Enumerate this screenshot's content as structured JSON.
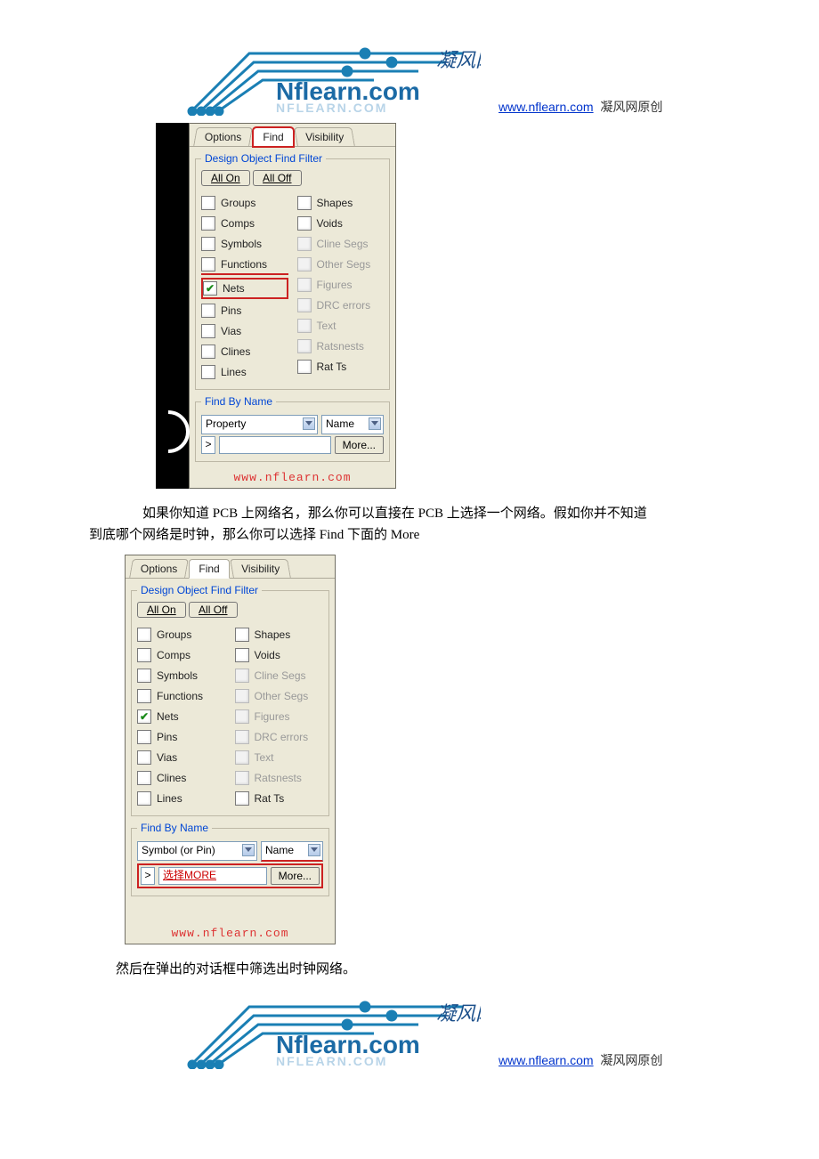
{
  "link_text": "www.nflearn.com",
  "credit_suffix": "凝风网原创",
  "tabs": {
    "options": "Options",
    "find": "Find",
    "visibility": "Visibility"
  },
  "group1_legend": "Design Object Find Filter",
  "all_on": "All On",
  "all_off": "All Off",
  "left_items": [
    "Groups",
    "Comps",
    "Symbols",
    "Functions",
    "Nets",
    "Pins",
    "Vias",
    "Clines",
    "Lines"
  ],
  "right_items": [
    {
      "label": "Shapes",
      "disabled": false
    },
    {
      "label": "Voids",
      "disabled": false
    },
    {
      "label": "Cline Segs",
      "disabled": true
    },
    {
      "label": "Other Segs",
      "disabled": true
    },
    {
      "label": "Figures",
      "disabled": true
    },
    {
      "label": "DRC errors",
      "disabled": true
    },
    {
      "label": "Text",
      "disabled": true
    },
    {
      "label": "Ratsnests",
      "disabled": true
    },
    {
      "label": "Rat Ts",
      "disabled": false
    }
  ],
  "group2_legend": "Find By Name",
  "select1_value": "Property",
  "select2_value": "Name",
  "more_label": "More...",
  "watermark": "www.nflearn.com",
  "paragraph1a": "如果你知道 PCB 上网络名，那么你可以直接在 PCB 上选择一个网络。假如你并不知道",
  "paragraph1b": "到底哪个网络是时钟，那么你可以选择 Find 下面的 More",
  "panel2_select1": "Symbol (or Pin)",
  "panel2_select2": "Name",
  "panel2_input": "选择MORE",
  "paragraph2": "然后在弹出的对话框中筛选出时钟网络。"
}
